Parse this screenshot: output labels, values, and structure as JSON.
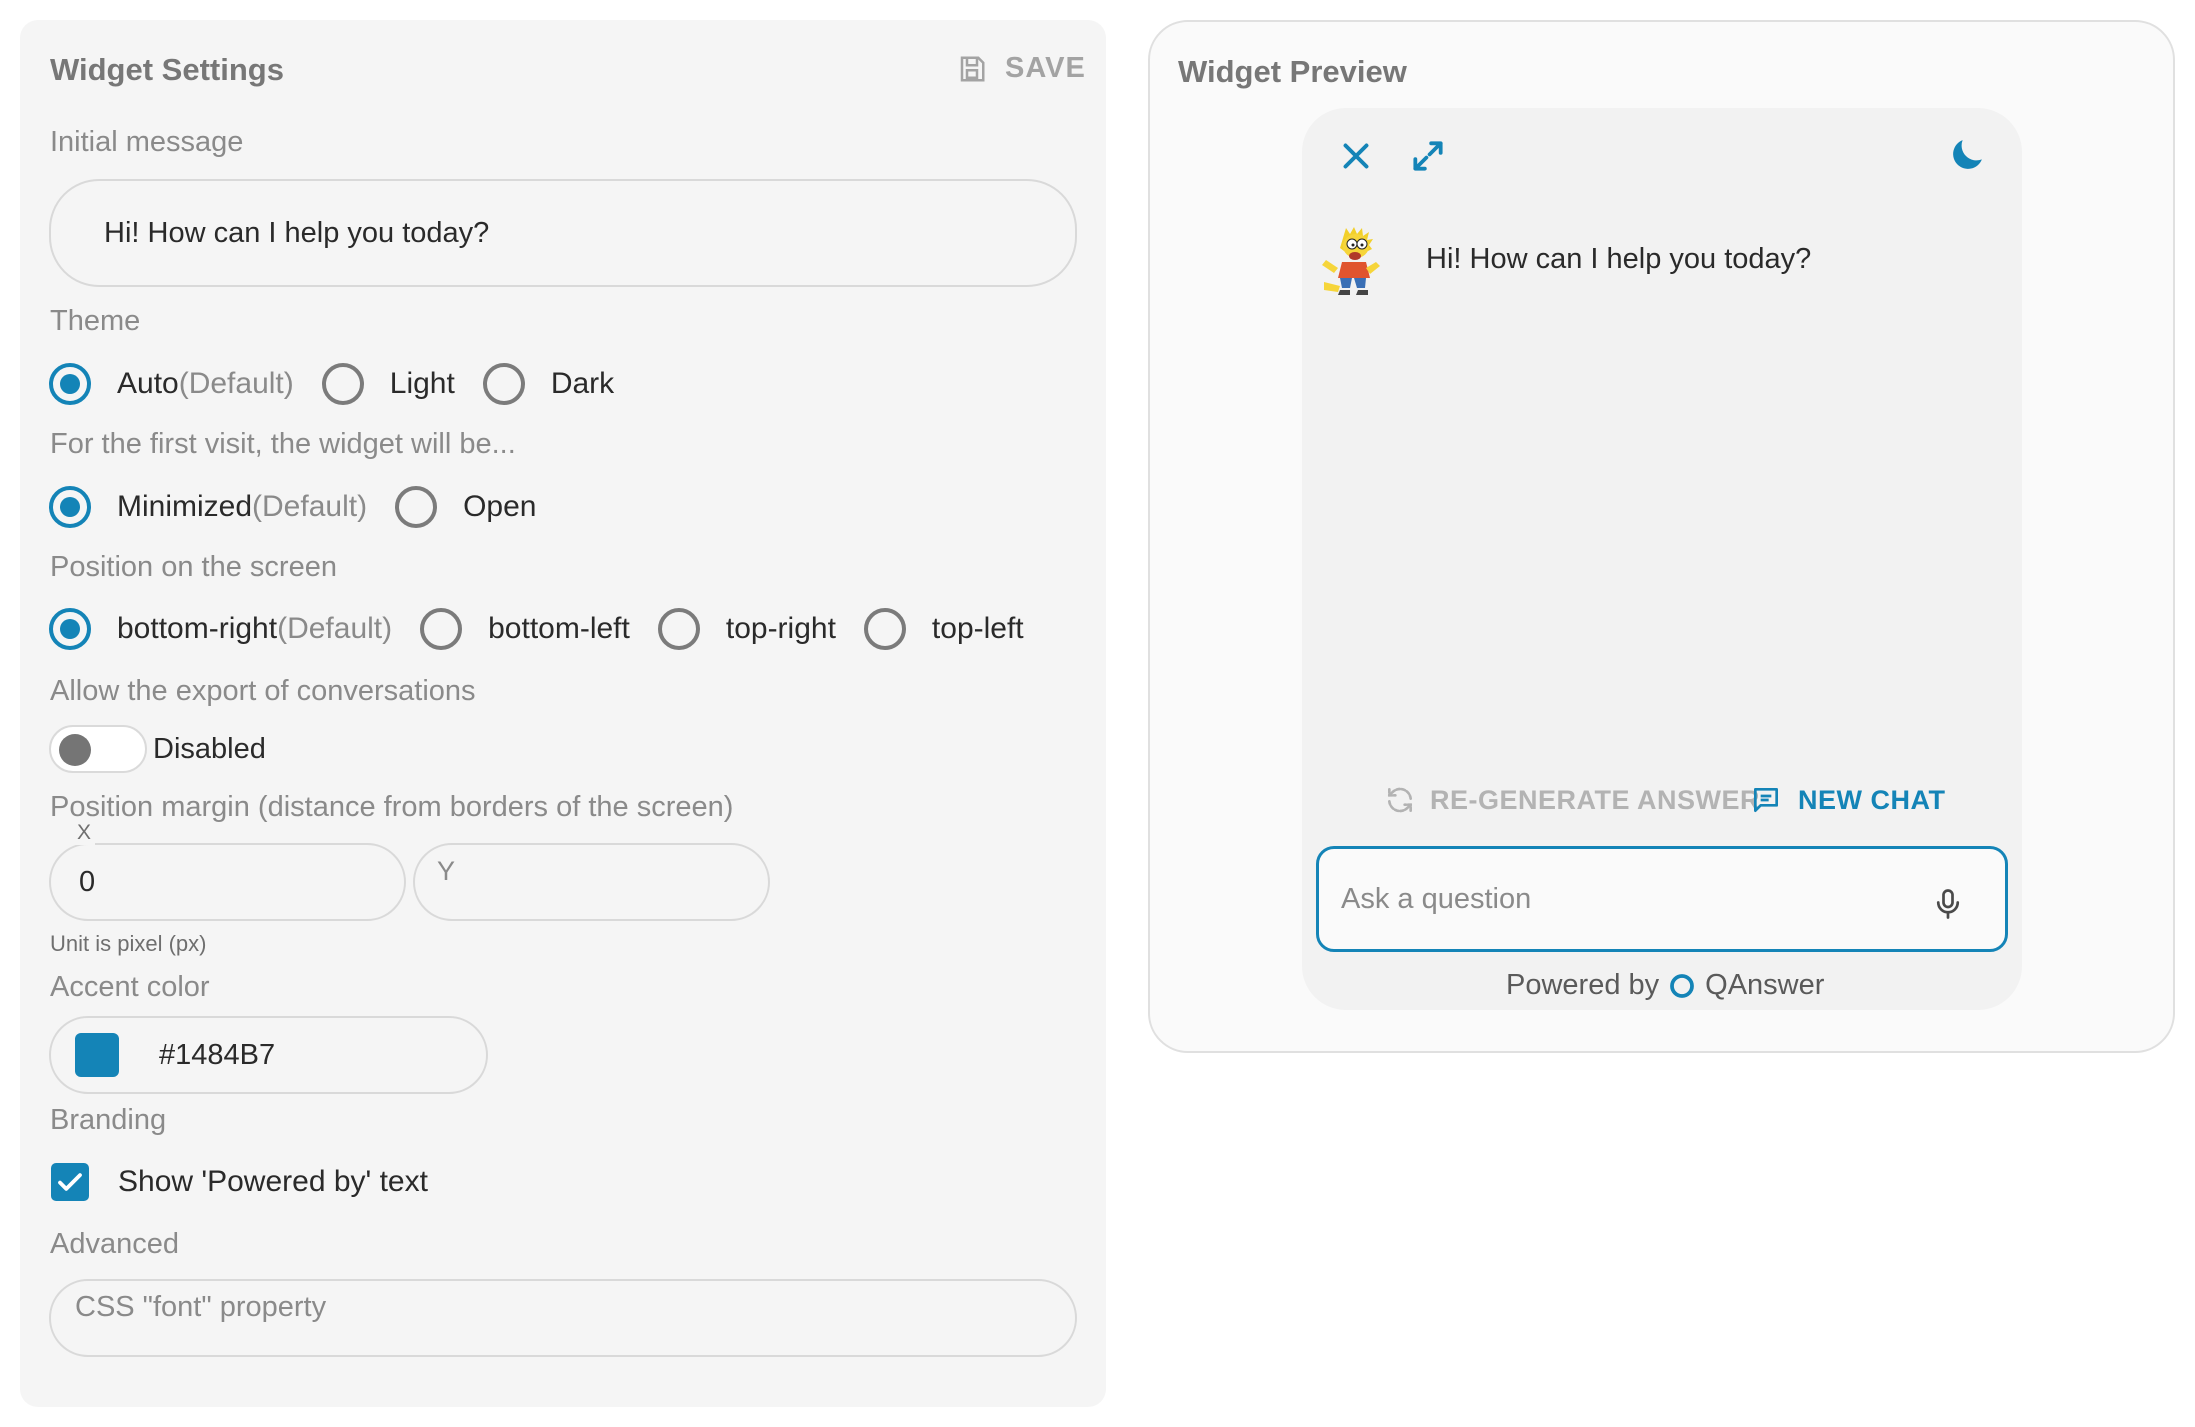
{
  "settings": {
    "title": "Widget Settings",
    "save_label": "SAVE",
    "initial_message": {
      "label": "Initial message",
      "value": "Hi! How can I help you today?"
    },
    "theme": {
      "label": "Theme",
      "selected": "Auto",
      "options": [
        {
          "label": "Auto",
          "suffix": "(Default)"
        },
        {
          "label": "Light",
          "suffix": ""
        },
        {
          "label": "Dark",
          "suffix": ""
        }
      ]
    },
    "first_visit": {
      "label": "For the first visit, the widget will be...",
      "selected": "Minimized",
      "options": [
        {
          "label": "Minimized",
          "suffix": "(Default)"
        },
        {
          "label": "Open",
          "suffix": ""
        }
      ]
    },
    "position": {
      "label": "Position on the screen",
      "selected": "bottom-right",
      "options": [
        {
          "label": "bottom-right",
          "suffix": "(Default)"
        },
        {
          "label": "bottom-left",
          "suffix": ""
        },
        {
          "label": "top-right",
          "suffix": ""
        },
        {
          "label": "top-left",
          "suffix": ""
        }
      ]
    },
    "export": {
      "label": "Allow the export of conversations",
      "toggle_enabled": false,
      "toggle_label": "Disabled"
    },
    "margin": {
      "label": "Position margin (distance from borders of the screen)",
      "x_label": "X",
      "x_value": "0",
      "y_label": "Y",
      "y_value": "",
      "unit_hint": "Unit is pixel (px)"
    },
    "accent": {
      "label": "Accent color",
      "value": "#1484B7"
    },
    "branding": {
      "label": "Branding",
      "checked": true,
      "checkbox_label": "Show 'Powered by' text"
    },
    "advanced": {
      "label": "Advanced",
      "font_placeholder": "CSS \"font\" property"
    }
  },
  "preview": {
    "title": "Widget Preview",
    "header_icons": [
      "close-icon",
      "expand-icon",
      "moon-icon"
    ],
    "bot_message": "Hi! How can I help you today?",
    "regenerate_label": "RE-GENERATE ANSWER",
    "new_chat_label": "NEW CHAT",
    "input_placeholder": "Ask a question",
    "powered_by_prefix": "Powered by",
    "powered_by_brand": "QAnswer"
  },
  "colors": {
    "accent": "#1484B7",
    "panel_bg": "#f5f5f5",
    "muted_text": "#8a8a8a"
  }
}
